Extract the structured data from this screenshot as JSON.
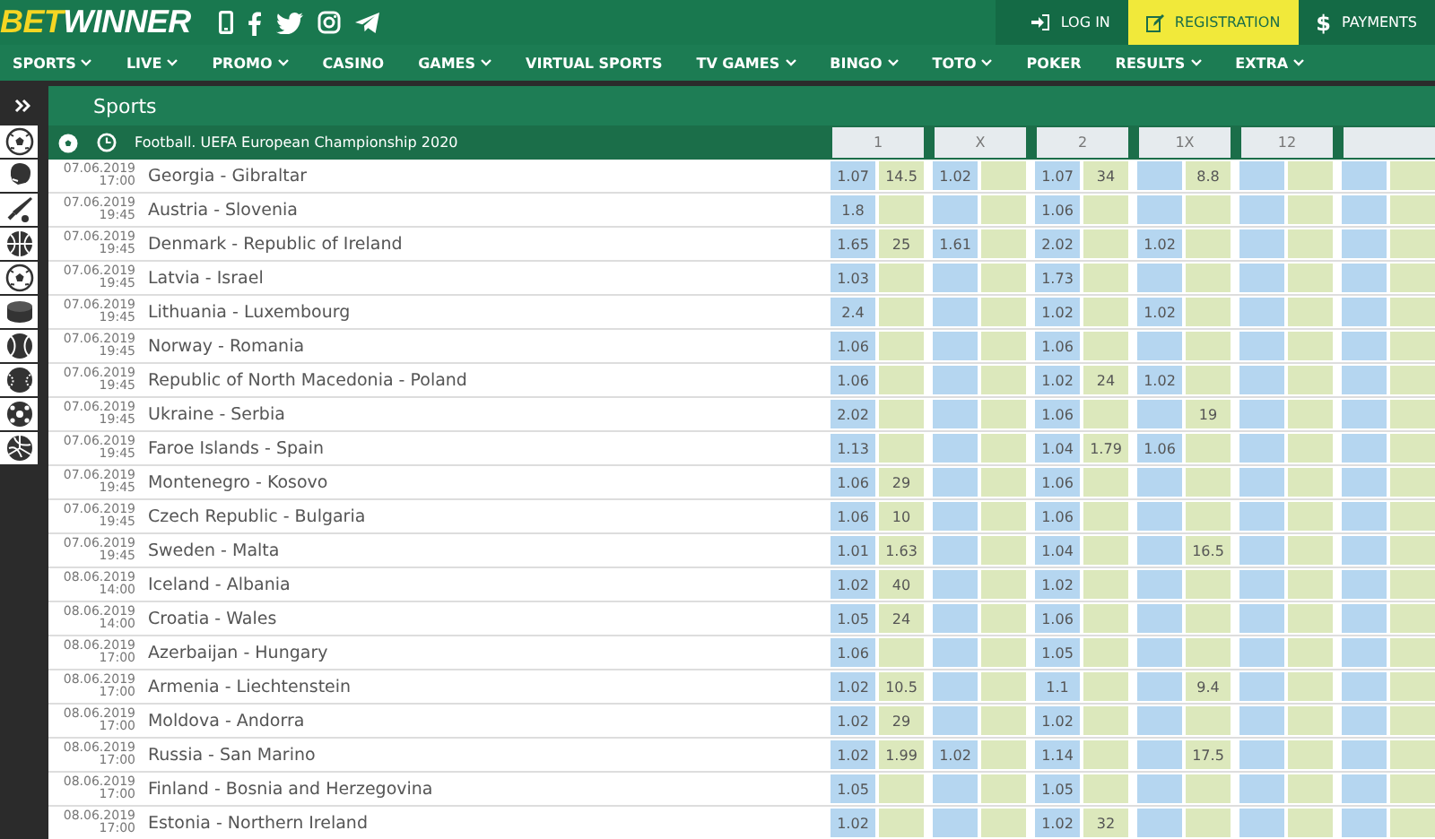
{
  "logo": {
    "part1": "BET",
    "part2": "WINNER"
  },
  "account": {
    "login": "LOG IN",
    "register": "REGISTRATION",
    "payments_symbol": "$",
    "payments": "PAYMENTS"
  },
  "nav": [
    {
      "label": "SPORTS",
      "has_dropdown": true
    },
    {
      "label": "LIVE",
      "has_dropdown": true
    },
    {
      "label": "PROMO",
      "has_dropdown": true
    },
    {
      "label": "CASINO",
      "has_dropdown": false
    },
    {
      "label": "GAMES",
      "has_dropdown": true
    },
    {
      "label": "VIRTUAL SPORTS",
      "has_dropdown": false
    },
    {
      "label": "TV GAMES",
      "has_dropdown": true
    },
    {
      "label": "BINGO",
      "has_dropdown": true
    },
    {
      "label": "TOTO",
      "has_dropdown": true
    },
    {
      "label": "POKER",
      "has_dropdown": false
    },
    {
      "label": "RESULTS",
      "has_dropdown": true
    },
    {
      "label": "EXTRA",
      "has_dropdown": true
    }
  ],
  "section_title": "Sports",
  "sidebar": {
    "items": [
      {
        "kind": "soccer"
      },
      {
        "kind": "glove"
      },
      {
        "kind": "bat"
      },
      {
        "kind": "basketball"
      },
      {
        "kind": "soccer"
      },
      {
        "kind": "puck"
      },
      {
        "kind": "tennis"
      },
      {
        "kind": "baseball"
      },
      {
        "kind": "handball"
      },
      {
        "kind": "volleyball"
      }
    ]
  },
  "competition": "Football. UEFA European Championship 2020",
  "columns": [
    "1",
    "X",
    "2",
    "1X",
    "12"
  ],
  "matches": [
    {
      "date": "07.06.2019",
      "time": "17:00",
      "teams": "Georgia - Gibraltar",
      "odds": {
        "c1a": "1.07",
        "c1b": "14.5",
        "cxa": "1.02",
        "c2a": "1.07",
        "c2b": "34",
        "c1xb": "8.8"
      }
    },
    {
      "date": "07.06.2019",
      "time": "19:45",
      "teams": "Austria - Slovenia",
      "odds": {
        "c1a": "1.8",
        "c2a": "1.06"
      }
    },
    {
      "date": "07.06.2019",
      "time": "19:45",
      "teams": "Denmark - Republic of Ireland",
      "odds": {
        "c1a": "1.65",
        "c1b": "25",
        "cxa": "1.61",
        "c2a": "2.02",
        "c1xa": "1.02"
      }
    },
    {
      "date": "07.06.2019",
      "time": "19:45",
      "teams": "Latvia - Israel",
      "odds": {
        "c1a": "1.03",
        "c2a": "1.73"
      }
    },
    {
      "date": "07.06.2019",
      "time": "19:45",
      "teams": "Lithuania - Luxembourg",
      "odds": {
        "c1a": "2.4",
        "c2a": "1.02",
        "c1xa": "1.02"
      }
    },
    {
      "date": "07.06.2019",
      "time": "19:45",
      "teams": "Norway - Romania",
      "odds": {
        "c1a": "1.06",
        "c2a": "1.06"
      }
    },
    {
      "date": "07.06.2019",
      "time": "19:45",
      "teams": "Republic of North Macedonia - Poland",
      "odds": {
        "c1a": "1.06",
        "c2a": "1.02",
        "c2b": "24",
        "c1xa": "1.02"
      }
    },
    {
      "date": "07.06.2019",
      "time": "19:45",
      "teams": "Ukraine - Serbia",
      "odds": {
        "c1a": "2.02",
        "c2a": "1.06",
        "c1xb": "19"
      }
    },
    {
      "date": "07.06.2019",
      "time": "19:45",
      "teams": "Faroe Islands - Spain",
      "odds": {
        "c1a": "1.13",
        "c2a": "1.04",
        "c2b": "1.79",
        "c1xa": "1.06"
      }
    },
    {
      "date": "07.06.2019",
      "time": "19:45",
      "teams": "Montenegro - Kosovo",
      "odds": {
        "c1a": "1.06",
        "c1b": "29",
        "c2a": "1.06"
      }
    },
    {
      "date": "07.06.2019",
      "time": "19:45",
      "teams": "Czech Republic - Bulgaria",
      "odds": {
        "c1a": "1.06",
        "c1b": "10",
        "c2a": "1.06"
      }
    },
    {
      "date": "07.06.2019",
      "time": "19:45",
      "teams": "Sweden - Malta",
      "odds": {
        "c1a": "1.01",
        "c1b": "1.63",
        "c2a": "1.04",
        "c1xb": "16.5"
      }
    },
    {
      "date": "08.06.2019",
      "time": "14:00",
      "teams": "Iceland - Albania",
      "odds": {
        "c1a": "1.02",
        "c1b": "40",
        "c2a": "1.02"
      }
    },
    {
      "date": "08.06.2019",
      "time": "14:00",
      "teams": "Croatia - Wales",
      "odds": {
        "c1a": "1.05",
        "c1b": "24",
        "c2a": "1.06"
      }
    },
    {
      "date": "08.06.2019",
      "time": "17:00",
      "teams": "Azerbaijan - Hungary",
      "odds": {
        "c1a": "1.06",
        "c2a": "1.05"
      }
    },
    {
      "date": "08.06.2019",
      "time": "17:00",
      "teams": "Armenia - Liechtenstein",
      "odds": {
        "c1a": "1.02",
        "c1b": "10.5",
        "c2a": "1.1",
        "c1xb": "9.4"
      }
    },
    {
      "date": "08.06.2019",
      "time": "17:00",
      "teams": "Moldova - Andorra",
      "odds": {
        "c1a": "1.02",
        "c1b": "29",
        "c2a": "1.02"
      }
    },
    {
      "date": "08.06.2019",
      "time": "17:00",
      "teams": "Russia - San Marino",
      "odds": {
        "c1a": "1.02",
        "c1b": "1.99",
        "cxa": "1.02",
        "c2a": "1.14",
        "c1xb": "17.5"
      }
    },
    {
      "date": "08.06.2019",
      "time": "17:00",
      "teams": "Finland - Bosnia and Herzegovina",
      "odds": {
        "c1a": "1.05",
        "c2a": "1.05"
      }
    },
    {
      "date": "08.06.2019",
      "time": "17:00",
      "teams": "Estonia - Northern Ireland",
      "odds": {
        "c1a": "1.02",
        "c2a": "1.02",
        "c2b": "32"
      }
    }
  ]
}
